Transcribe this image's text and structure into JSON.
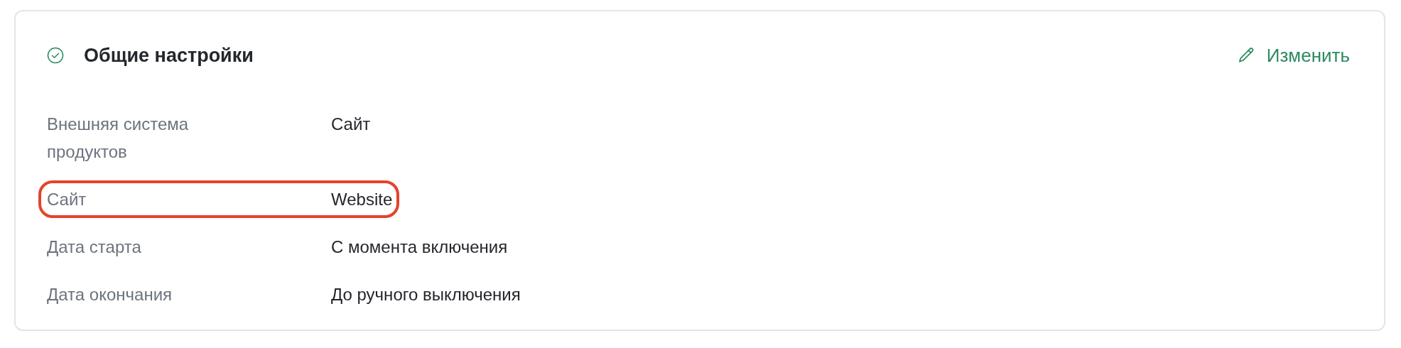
{
  "section": {
    "title": "Общие настройки",
    "completed": true,
    "edit_label": "Изменить"
  },
  "rows": [
    {
      "label": "Внешняя система продуктов",
      "value": "Сайт",
      "highlighted": false
    },
    {
      "label": "Сайт",
      "value": "Website",
      "highlighted": true
    },
    {
      "label": "Дата старта",
      "value": "С момента включения",
      "highlighted": false
    },
    {
      "label": "Дата окончания",
      "value": "До ручного выключения",
      "highlighted": false
    }
  ]
}
